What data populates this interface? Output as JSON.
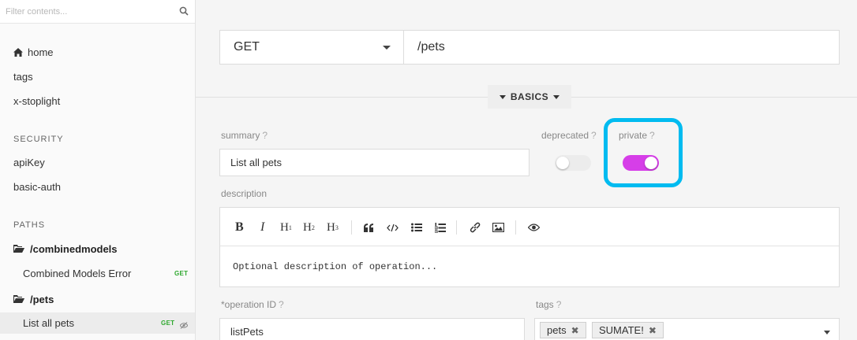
{
  "sidebar": {
    "filter_placeholder": "Filter contents...",
    "nav": [
      {
        "label": "home",
        "icon": "home-icon"
      },
      {
        "label": "tags"
      },
      {
        "label": "x-stoplight"
      }
    ],
    "security_title": "SECURITY",
    "security_items": [
      "apiKey",
      "basic-auth"
    ],
    "paths_title": "PATHS",
    "groups": [
      {
        "label": "/combinedmodels",
        "ops": [
          {
            "label": "Combined Models Error",
            "method": "GET"
          }
        ]
      },
      {
        "label": "/pets",
        "ops": [
          {
            "label": "List all pets",
            "method": "GET",
            "active": true
          }
        ]
      }
    ]
  },
  "request": {
    "method": "GET",
    "path": "/pets"
  },
  "basics_label": "BASICS",
  "form": {
    "summary_label": "summary",
    "summary_value": "List all pets",
    "deprecated_label": "deprecated",
    "deprecated_on": false,
    "private_label": "private",
    "private_on": true,
    "help_mark": "?",
    "description_label": "description",
    "description_placeholder": "Optional description of operation...",
    "operation_id_label": "*operation ID",
    "operation_id_value": "listPets",
    "tags_label": "tags",
    "tags": [
      "pets",
      "SUMATE!"
    ],
    "tag_remove": "✖"
  },
  "toolbar": {
    "bold": "B",
    "italic": "I",
    "h1": "H",
    "h2": "H",
    "h3": "H",
    "h1_sub": "1",
    "h2_sub": "2",
    "h3_sub": "3"
  },
  "colors": {
    "toggle_on": "#d63ee8",
    "toggle_off": "#ececec",
    "highlight": "#00bbf0",
    "method_get": "#2ea82e"
  }
}
